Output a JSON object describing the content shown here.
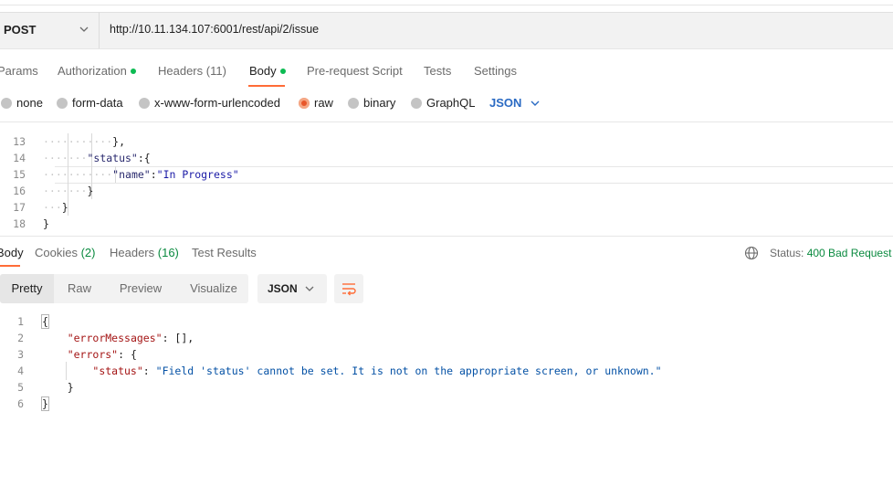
{
  "request": {
    "method": "POST",
    "url": "http://10.11.134.107:6001/rest/api/2/issue"
  },
  "request_tabs": [
    {
      "label": "Params",
      "dot": false
    },
    {
      "label": "Authorization",
      "dot": true
    },
    {
      "label": "Headers (11)",
      "dot": false
    },
    {
      "label": "Body",
      "dot": true,
      "active": true
    },
    {
      "label": "Pre-request Script",
      "dot": false
    },
    {
      "label": "Tests",
      "dot": false
    },
    {
      "label": "Settings",
      "dot": false
    }
  ],
  "body_types": [
    {
      "label": "none",
      "selected": false
    },
    {
      "label": "form-data",
      "selected": false
    },
    {
      "label": "x-www-form-urlencoded",
      "selected": false
    },
    {
      "label": "raw",
      "selected": true
    },
    {
      "label": "binary",
      "selected": false
    },
    {
      "label": "GraphQL",
      "selected": false
    }
  ],
  "body_format": "JSON",
  "request_code": {
    "line_numbers": [
      "13",
      "14",
      "15",
      "16",
      "17",
      "18"
    ],
    "line13": "},",
    "line14_key": "\"status\"",
    "line14_rest": ":{",
    "line15_key": "\"name\"",
    "line15_colon": ":",
    "line15_val": "\"In Progress\"",
    "line16": "}",
    "line17": "}",
    "line18": "}"
  },
  "response_tabs": {
    "body": "Body",
    "cookies": "Cookies",
    "cookies_count": "(2)",
    "headers": "Headers",
    "headers_count": "(16)",
    "test_results": "Test Results"
  },
  "status": {
    "label": "Status:",
    "value": "400 Bad Request"
  },
  "view_modes": [
    "Pretty",
    "Raw",
    "Preview",
    "Visualize"
  ],
  "response_format": "JSON",
  "response_code": {
    "line_numbers": [
      "1",
      "2",
      "3",
      "4",
      "5",
      "6"
    ],
    "l1": "{",
    "l2_key": "\"errorMessages\"",
    "l2_rest": ": [],",
    "l3_key": "\"errors\"",
    "l3_rest": ": {",
    "l4_key": "\"status\"",
    "l4_colon": ": ",
    "l4_val": "\"Field 'status' cannot be set. It is not on the appropriate screen, or unknown.\"",
    "l5": "}",
    "l6": "}"
  },
  "colors": {
    "accent": "#ff6c37",
    "dot_green": "#0cbb52",
    "status_green": "#0a8a3f",
    "link_blue": "#2a6ac3"
  }
}
